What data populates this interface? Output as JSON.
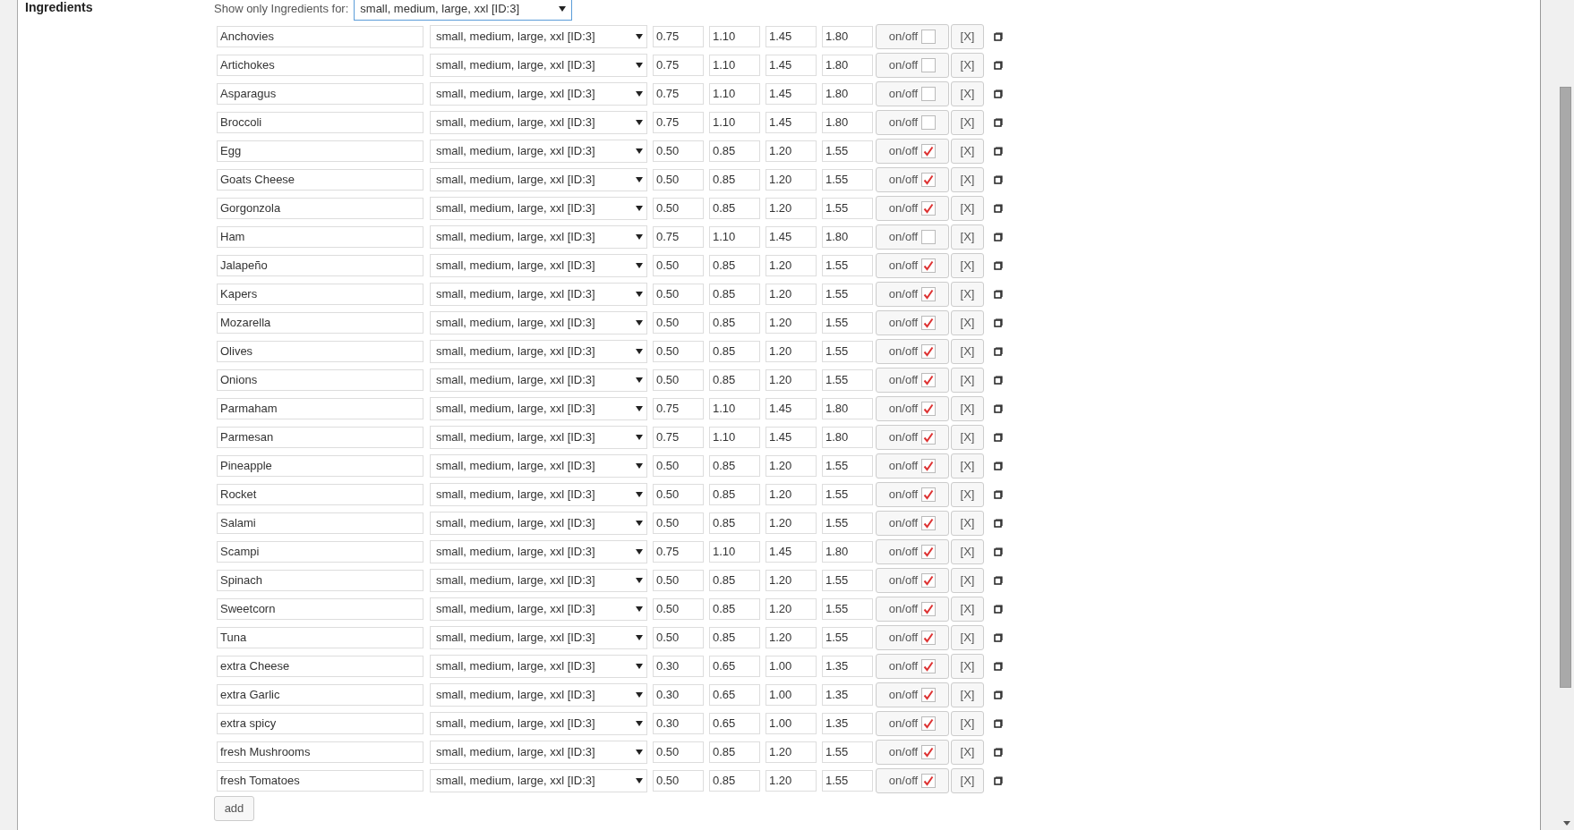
{
  "section_label": "Ingredients",
  "filter": {
    "label": "Show only Ingredients for:",
    "value": "small, medium, large, xxl [ID:3]"
  },
  "ingredients": [
    {
      "name": "Anchovies",
      "sizes": "small, medium, large, xxl [ID:3]",
      "prices": [
        "0.75",
        "1.10",
        "1.45",
        "1.80"
      ],
      "toggle_label": "on/off",
      "checked": false,
      "remove": "[X]"
    },
    {
      "name": "Artichokes",
      "sizes": "small, medium, large, xxl [ID:3]",
      "prices": [
        "0.75",
        "1.10",
        "1.45",
        "1.80"
      ],
      "toggle_label": "on/off",
      "checked": false,
      "remove": "[X]"
    },
    {
      "name": "Asparagus",
      "sizes": "small, medium, large, xxl [ID:3]",
      "prices": [
        "0.75",
        "1.10",
        "1.45",
        "1.80"
      ],
      "toggle_label": "on/off",
      "checked": false,
      "remove": "[X]"
    },
    {
      "name": "Broccoli",
      "sizes": "small, medium, large, xxl [ID:3]",
      "prices": [
        "0.75",
        "1.10",
        "1.45",
        "1.80"
      ],
      "toggle_label": "on/off",
      "checked": false,
      "remove": "[X]"
    },
    {
      "name": "Egg",
      "sizes": "small, medium, large, xxl [ID:3]",
      "prices": [
        "0.50",
        "0.85",
        "1.20",
        "1.55"
      ],
      "toggle_label": "on/off",
      "checked": true,
      "remove": "[X]"
    },
    {
      "name": "Goats Cheese",
      "sizes": "small, medium, large, xxl [ID:3]",
      "prices": [
        "0.50",
        "0.85",
        "1.20",
        "1.55"
      ],
      "toggle_label": "on/off",
      "checked": true,
      "remove": "[X]"
    },
    {
      "name": "Gorgonzola",
      "sizes": "small, medium, large, xxl [ID:3]",
      "prices": [
        "0.50",
        "0.85",
        "1.20",
        "1.55"
      ],
      "toggle_label": "on/off",
      "checked": true,
      "remove": "[X]"
    },
    {
      "name": "Ham",
      "sizes": "small, medium, large, xxl [ID:3]",
      "prices": [
        "0.75",
        "1.10",
        "1.45",
        "1.80"
      ],
      "toggle_label": "on/off",
      "checked": false,
      "remove": "[X]"
    },
    {
      "name": "Jalapeño",
      "sizes": "small, medium, large, xxl [ID:3]",
      "prices": [
        "0.50",
        "0.85",
        "1.20",
        "1.55"
      ],
      "toggle_label": "on/off",
      "checked": true,
      "remove": "[X]"
    },
    {
      "name": "Kapers",
      "sizes": "small, medium, large, xxl [ID:3]",
      "prices": [
        "0.50",
        "0.85",
        "1.20",
        "1.55"
      ],
      "toggle_label": "on/off",
      "checked": true,
      "remove": "[X]"
    },
    {
      "name": "Mozarella",
      "sizes": "small, medium, large, xxl [ID:3]",
      "prices": [
        "0.50",
        "0.85",
        "1.20",
        "1.55"
      ],
      "toggle_label": "on/off",
      "checked": true,
      "remove": "[X]"
    },
    {
      "name": "Olives",
      "sizes": "small, medium, large, xxl [ID:3]",
      "prices": [
        "0.50",
        "0.85",
        "1.20",
        "1.55"
      ],
      "toggle_label": "on/off",
      "checked": true,
      "remove": "[X]"
    },
    {
      "name": "Onions",
      "sizes": "small, medium, large, xxl [ID:3]",
      "prices": [
        "0.50",
        "0.85",
        "1.20",
        "1.55"
      ],
      "toggle_label": "on/off",
      "checked": true,
      "remove": "[X]"
    },
    {
      "name": "Parmaham",
      "sizes": "small, medium, large, xxl [ID:3]",
      "prices": [
        "0.75",
        "1.10",
        "1.45",
        "1.80"
      ],
      "toggle_label": "on/off",
      "checked": true,
      "remove": "[X]"
    },
    {
      "name": "Parmesan",
      "sizes": "small, medium, large, xxl [ID:3]",
      "prices": [
        "0.75",
        "1.10",
        "1.45",
        "1.80"
      ],
      "toggle_label": "on/off",
      "checked": true,
      "remove": "[X]"
    },
    {
      "name": "Pineapple",
      "sizes": "small, medium, large, xxl [ID:3]",
      "prices": [
        "0.50",
        "0.85",
        "1.20",
        "1.55"
      ],
      "toggle_label": "on/off",
      "checked": true,
      "remove": "[X]"
    },
    {
      "name": "Rocket",
      "sizes": "small, medium, large, xxl [ID:3]",
      "prices": [
        "0.50",
        "0.85",
        "1.20",
        "1.55"
      ],
      "toggle_label": "on/off",
      "checked": true,
      "remove": "[X]"
    },
    {
      "name": "Salami",
      "sizes": "small, medium, large, xxl [ID:3]",
      "prices": [
        "0.50",
        "0.85",
        "1.20",
        "1.55"
      ],
      "toggle_label": "on/off",
      "checked": true,
      "remove": "[X]"
    },
    {
      "name": "Scampi",
      "sizes": "small, medium, large, xxl [ID:3]",
      "prices": [
        "0.75",
        "1.10",
        "1.45",
        "1.80"
      ],
      "toggle_label": "on/off",
      "checked": true,
      "remove": "[X]"
    },
    {
      "name": "Spinach",
      "sizes": "small, medium, large, xxl [ID:3]",
      "prices": [
        "0.50",
        "0.85",
        "1.20",
        "1.55"
      ],
      "toggle_label": "on/off",
      "checked": true,
      "remove": "[X]"
    },
    {
      "name": "Sweetcorn",
      "sizes": "small, medium, large, xxl [ID:3]",
      "prices": [
        "0.50",
        "0.85",
        "1.20",
        "1.55"
      ],
      "toggle_label": "on/off",
      "checked": true,
      "remove": "[X]"
    },
    {
      "name": "Tuna",
      "sizes": "small, medium, large, xxl [ID:3]",
      "prices": [
        "0.50",
        "0.85",
        "1.20",
        "1.55"
      ],
      "toggle_label": "on/off",
      "checked": true,
      "remove": "[X]"
    },
    {
      "name": "extra Cheese",
      "sizes": "small, medium, large, xxl [ID:3]",
      "prices": [
        "0.30",
        "0.65",
        "1.00",
        "1.35"
      ],
      "toggle_label": "on/off",
      "checked": true,
      "remove": "[X]"
    },
    {
      "name": "extra Garlic",
      "sizes": "small, medium, large, xxl [ID:3]",
      "prices": [
        "0.30",
        "0.65",
        "1.00",
        "1.35"
      ],
      "toggle_label": "on/off",
      "checked": true,
      "remove": "[X]"
    },
    {
      "name": "extra spicy",
      "sizes": "small, medium, large, xxl [ID:3]",
      "prices": [
        "0.30",
        "0.65",
        "1.00",
        "1.35"
      ],
      "toggle_label": "on/off",
      "checked": true,
      "remove": "[X]"
    },
    {
      "name": "fresh Mushrooms",
      "sizes": "small, medium, large, xxl [ID:3]",
      "prices": [
        "0.50",
        "0.85",
        "1.20",
        "1.55"
      ],
      "toggle_label": "on/off",
      "checked": true,
      "remove": "[X]"
    },
    {
      "name": "fresh Tomatoes",
      "sizes": "small, medium, large, xxl [ID:3]",
      "prices": [
        "0.50",
        "0.85",
        "1.20",
        "1.55"
      ],
      "toggle_label": "on/off",
      "checked": true,
      "remove": "[X]"
    }
  ],
  "add_button": "add"
}
